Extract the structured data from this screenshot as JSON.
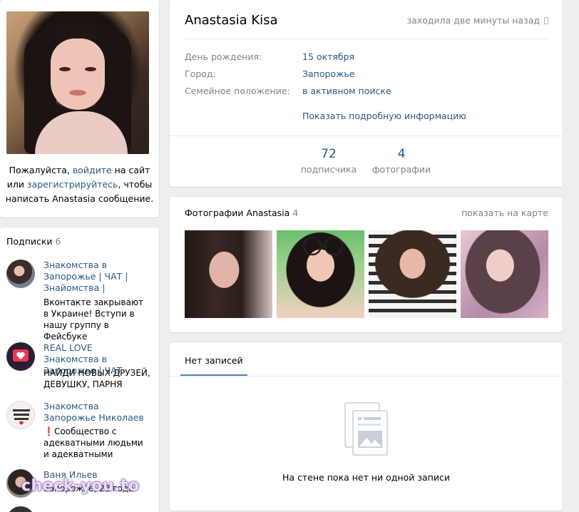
{
  "profile": {
    "name": "Anastasia Kisa",
    "last_seen": "заходила две минуты назад",
    "fields": [
      {
        "label": "День рождения:",
        "value": "15 октября"
      },
      {
        "label": "Город:",
        "value": "Запорожье"
      },
      {
        "label": "Семейное положение:",
        "value": "в активном поиске"
      }
    ],
    "show_more": "Показать подробную информацию",
    "stats": [
      {
        "num": "72",
        "label": "подписчика"
      },
      {
        "num": "4",
        "label": "фотографии"
      }
    ]
  },
  "message_prompt": {
    "before": "Пожалуйста, ",
    "login": "войдите",
    "middle": " на сайт или ",
    "register": "зарегистрируйтесь",
    "after": ", чтобы написать Anastasia сообщение."
  },
  "subscriptions": {
    "title": "Подписки",
    "count": "6",
    "items": [
      {
        "name": "Знакомства в Запорожье | ЧАТ | Знайомства |",
        "desc": "Вконтакте закрывают в Украине! Вступи в нашу группу в Фейсбуке"
      },
      {
        "name": "REAL LOVE Знакомства в Запорожье | ЧАТ",
        "desc": "НАЙДИ НОВЫХ ДРУЗЕЙ, ДЕВУШКУ, ПАРНЯ"
      },
      {
        "name": "Знакомства Запорожье Николаев",
        "desc": "❗Сообщество с адекватными людьми и адекватными"
      },
      {
        "name": "Ваня Ильев",
        "desc": "Запорожье, 22 года"
      }
    ]
  },
  "photos": {
    "title": "Фотографии Anastasia",
    "count": "4",
    "map_link": "показать на карте"
  },
  "wall": {
    "tab": "Нет записей",
    "empty_text": "На стене пока нет ни одной записи"
  },
  "watermark": "check-you.to",
  "colors": {
    "link": "#2a5885",
    "muted": "#828282",
    "accent": "#5181b8",
    "background": "#edeef0"
  }
}
